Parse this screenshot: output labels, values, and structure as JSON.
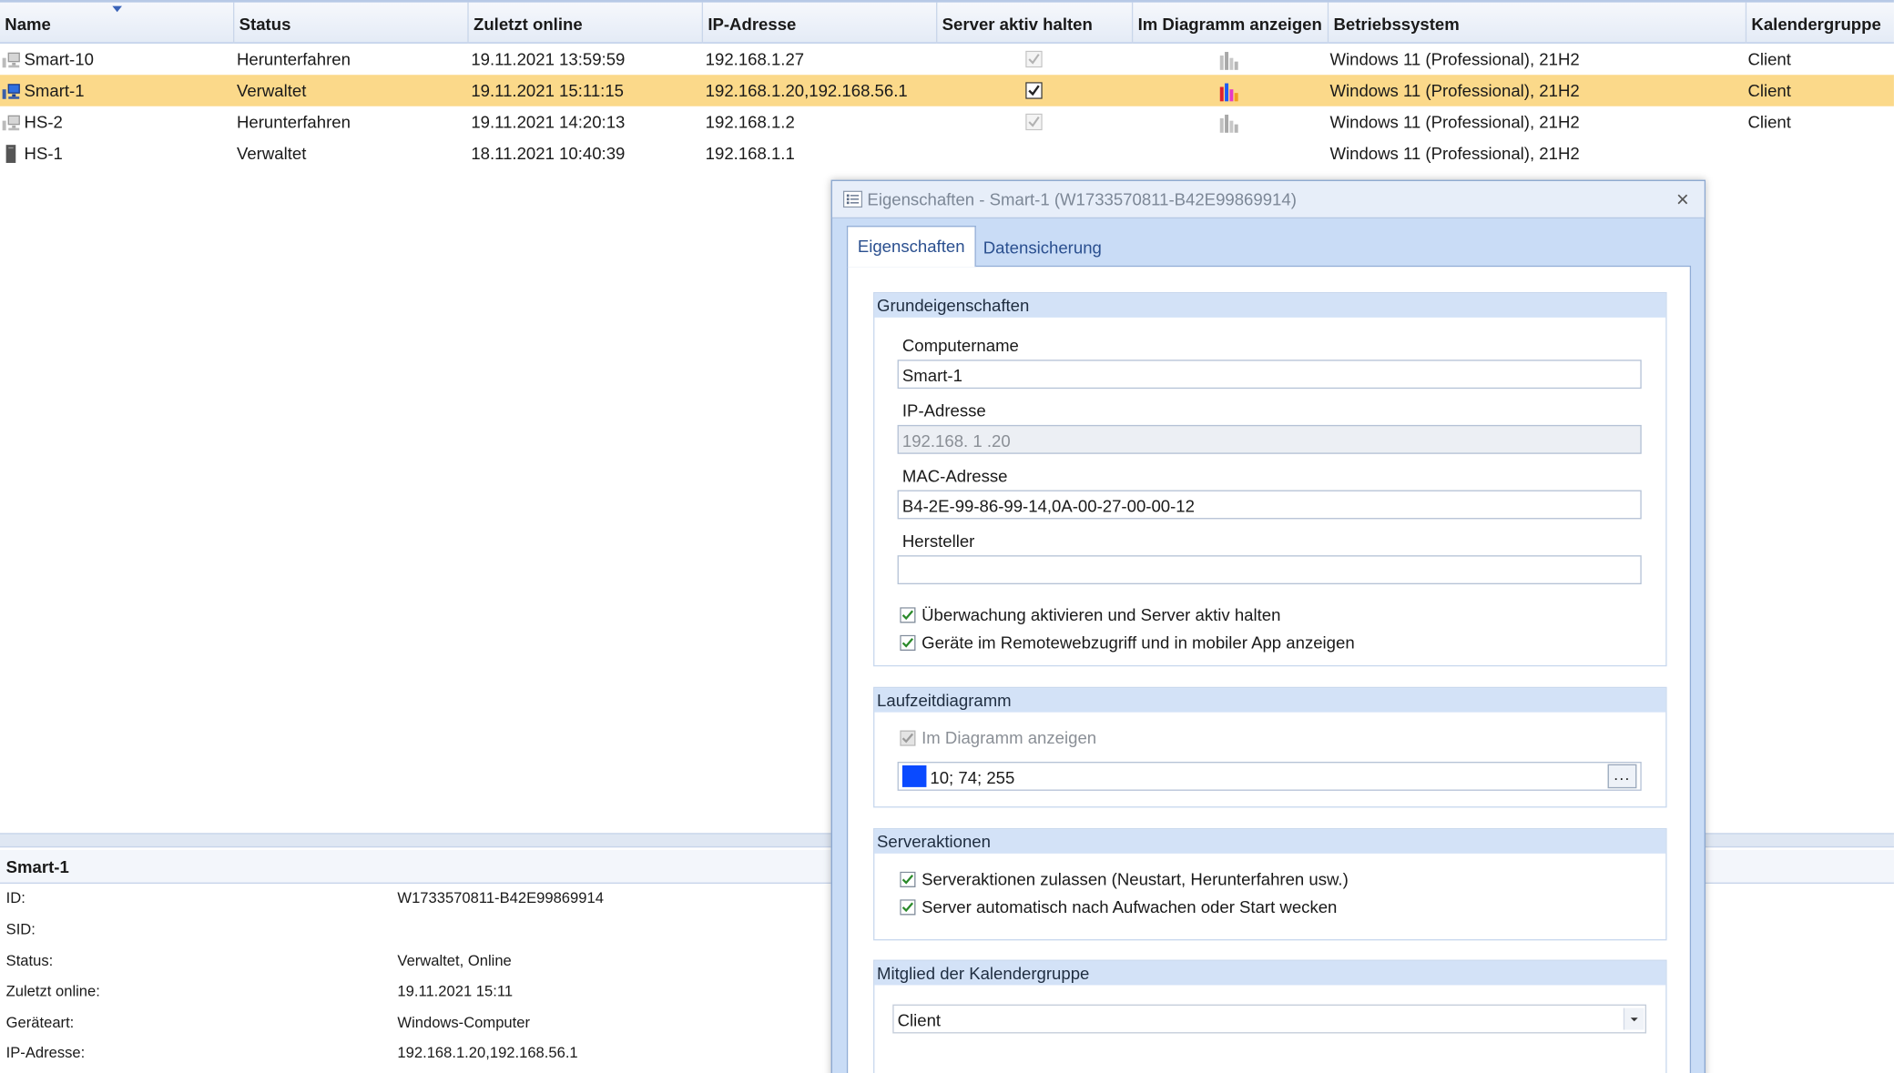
{
  "columns": [
    "Name",
    "Status",
    "Zuletzt online",
    "IP-Adresse",
    "Server aktiv halten",
    "Im Diagramm anzeigen",
    "Betriebssystem",
    "Kalendergruppe"
  ],
  "rows": [
    {
      "name": "Smart-10",
      "status": "Herunterfahren",
      "online": "19.11.2021 13:59:59",
      "ip": "192.168.1.27",
      "keep_active": true,
      "in_chart": true,
      "os": "Windows 11 (Professional), 21H2",
      "group": "Client",
      "selected": false
    },
    {
      "name": "Smart-1",
      "status": "Verwaltet",
      "online": "19.11.2021 15:11:15",
      "ip": "192.168.1.20,192.168.56.1",
      "keep_active": true,
      "in_chart": true,
      "os": "Windows 11 (Professional), 21H2",
      "group": "Client",
      "selected": true
    },
    {
      "name": "HS-2",
      "status": "Herunterfahren",
      "online": "19.11.2021 14:20:13",
      "ip": "192.168.1.2",
      "keep_active": true,
      "in_chart": true,
      "os": "Windows 11 (Professional), 21H2",
      "group": "Client",
      "selected": false
    },
    {
      "name": "HS-1",
      "status": "Verwaltet",
      "online": "18.11.2021 10:40:39",
      "ip": "192.168.1.1",
      "keep_active": false,
      "in_chart": false,
      "os": "Windows 11 (Professional), 21H2",
      "group": "",
      "selected": false
    }
  ],
  "details": {
    "title": "Smart-1",
    "rows": [
      {
        "k": "ID:",
        "v": "W1733570811-B42E99869914"
      },
      {
        "k": "SID:",
        "v": ""
      },
      {
        "k": "Status:",
        "v": "Verwaltet, Online"
      },
      {
        "k": "Zuletzt online:",
        "v": "19.11.2021 15:11"
      },
      {
        "k": "Geräteart:",
        "v": "Windows-Computer"
      },
      {
        "k": "IP-Adresse:",
        "v": "192.168.1.20,192.168.56.1"
      }
    ]
  },
  "dialog": {
    "title": "Eigenschaften - Smart-1 (W1733570811-B42E99869914)",
    "close": "×",
    "tabs": [
      "Eigenschaften",
      "Datensicherung"
    ],
    "basic": {
      "header": "Grundeigenschaften",
      "computername_label": "Computername",
      "computername": "Smart-1",
      "ip_label": "IP-Adresse",
      "ip": "192.168. 1 .20",
      "mac_label": "MAC-Adresse",
      "mac": "B4-2E-99-86-99-14,0A-00-27-00-00-12",
      "vendor_label": "Hersteller",
      "vendor": "",
      "cb1": "Überwachung aktivieren und Server aktiv halten",
      "cb2": "Geräte im Remotewebzugriff und in mobiler App anzeigen"
    },
    "chart": {
      "header": "Laufzeitdiagramm",
      "cb": "Im Diagramm anzeigen",
      "color_value": "10; 74; 255",
      "color_hex": "#0a4aff",
      "dots": "..."
    },
    "actions": {
      "header": "Serveraktionen",
      "cb1": "Serveraktionen zulassen (Neustart, Herunterfahren usw.)",
      "cb2": "Server automatisch nach Aufwachen oder Start wecken"
    },
    "calendar": {
      "header": "Mitglied der Kalendergruppe",
      "value": "Client"
    }
  },
  "colors": {
    "selection": "#fbd98a",
    "accent": "#3a63b8",
    "group_header": "#d3e2f7"
  }
}
